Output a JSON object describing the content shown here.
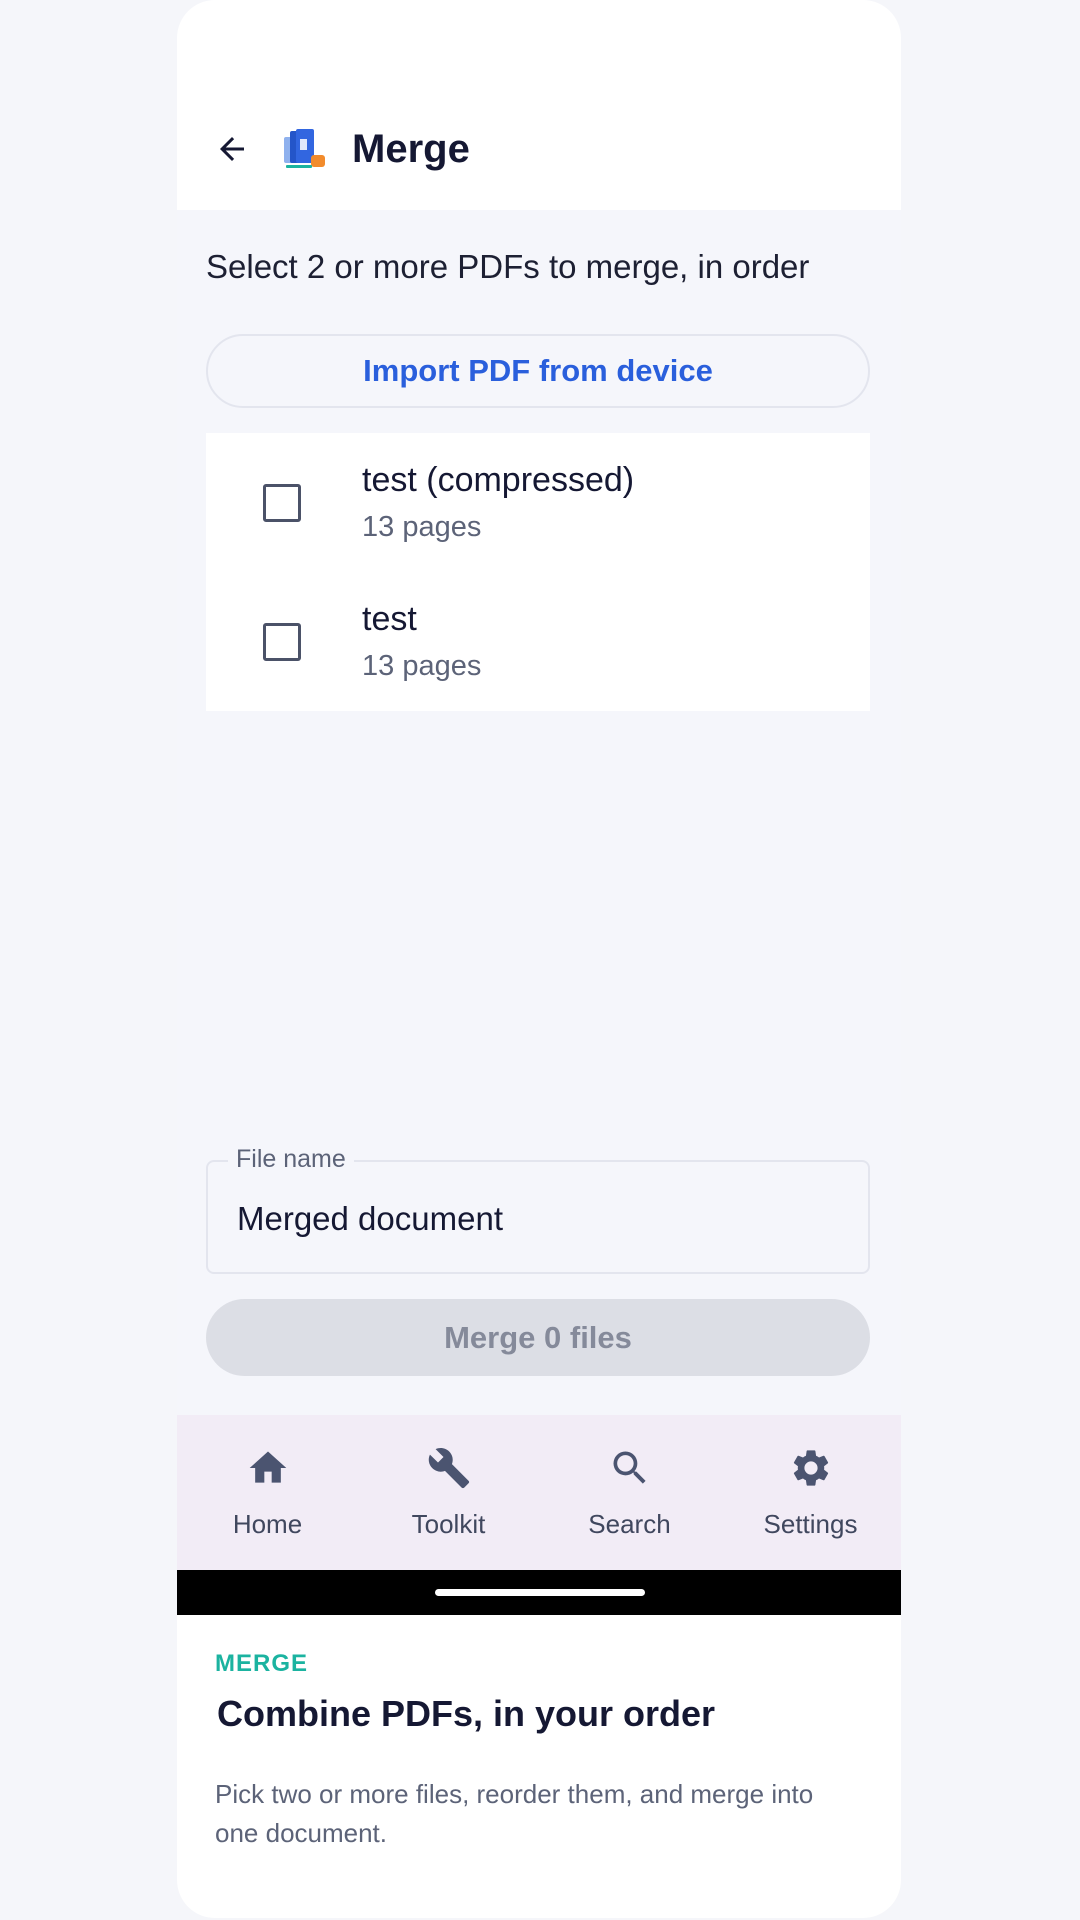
{
  "header": {
    "title": "Merge"
  },
  "main": {
    "subtitle": "Select 2 or more PDFs to merge, in order",
    "import_label": "Import PDF from device",
    "files": [
      {
        "name": "test (compressed)",
        "pages": "13 pages",
        "checked": false
      },
      {
        "name": "test",
        "pages": "13 pages",
        "checked": false
      }
    ],
    "filename_label": "File name",
    "filename_value": "Merged document",
    "merge_label": "Merge 0 files"
  },
  "nav": {
    "items": [
      {
        "label": "Home",
        "icon": "home-icon"
      },
      {
        "label": "Toolkit",
        "icon": "wrench-icon"
      },
      {
        "label": "Search",
        "icon": "search-icon"
      },
      {
        "label": "Settings",
        "icon": "gear-icon"
      }
    ]
  },
  "caption": {
    "kicker": "MERGE",
    "heading": "Combine PDFs, in your order",
    "body": "Pick two or more files, reorder them, and merge into one document."
  },
  "colors": {
    "accent": "#2a5fdc",
    "kicker": "#1bb3a0",
    "nav_background": "#f2ecf6",
    "disabled_button": "#dcdee5"
  }
}
